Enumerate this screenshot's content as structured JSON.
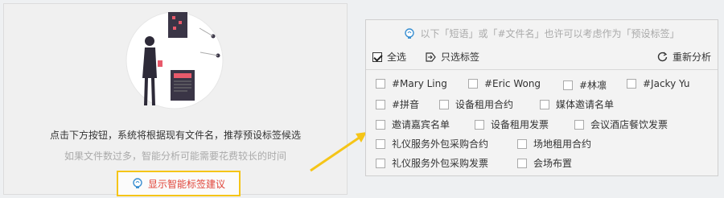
{
  "colors": {
    "highlight_border": "#f5c518",
    "accent_red": "#e0453a",
    "arrow": "#f5c518",
    "muted_text": "#aaaaaa"
  },
  "left": {
    "description": "点击下方按钮，系统将根据现有文件名，推荐预设标签候选",
    "subnote": "如果文件数过多，智能分析可能需要花费较长的时间",
    "suggest_button": {
      "icon": "lightbulb-icon",
      "label": "显示智能标签建议"
    }
  },
  "right": {
    "hint": "以下「短语」或「#文件名」也许可以考虑作为「预设标签」",
    "hint_icon": "lightbulb-icon",
    "select_all": {
      "label": "全选",
      "checked": true
    },
    "select_only_tags": {
      "label": "只选标签",
      "icon": "tag-arrow-icon"
    },
    "reanalyze": {
      "label": "重新分析",
      "icon": "refresh-icon"
    },
    "tags": [
      {
        "label": "#Mary Ling",
        "checked": false
      },
      {
        "label": "#Eric Wong",
        "checked": false
      },
      {
        "label": "#林凛",
        "checked": false
      },
      {
        "label": "#Jacky Yu",
        "checked": false
      },
      {
        "label": "#拼音",
        "checked": false
      },
      {
        "label": "设备租用合约",
        "checked": false
      },
      {
        "label": "媒体邀请名单",
        "checked": false
      },
      {
        "label": "邀请嘉宾名单",
        "checked": false
      },
      {
        "label": "设备租用发票",
        "checked": false
      },
      {
        "label": "会议酒店餐饮发票",
        "checked": false
      },
      {
        "label": "礼仪服务外包采购合约",
        "checked": false
      },
      {
        "label": "场地租用合约",
        "checked": false
      },
      {
        "label": "礼仪服务外包采购发票",
        "checked": false
      },
      {
        "label": "会场布置",
        "checked": false
      }
    ]
  }
}
